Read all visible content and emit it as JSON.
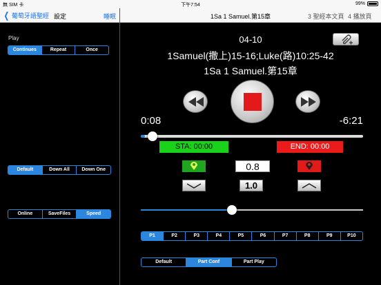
{
  "status_bar": {
    "carrier": "無 SIM 卡",
    "time": "下午7:54",
    "battery": "99%"
  },
  "sidebar": {
    "back_label": "葡萄牙語聖經",
    "title": "設定",
    "action": "睡眠",
    "play_label": "Play",
    "play_modes": [
      "Continues",
      "Repeat",
      "Once"
    ],
    "play_mode_selected": "Continues",
    "scroll_modes": [
      "Default",
      "Down All",
      "Down One"
    ],
    "scroll_mode_selected": "Default",
    "source_modes": [
      "Online",
      "SaveFiles",
      "Speed"
    ],
    "source_mode_selected": "Speed"
  },
  "player": {
    "chapter_title": "1Sa 1 Samuel.第15章",
    "nav_text_link": "3 聖經本文頁",
    "nav_play_link": "4 播放頁",
    "date": "04-10",
    "reading_ref": "1Samuel(撒上)15-16;Luke(路)10:25-42",
    "chapter_name": "1Sa 1 Samuel.第15章",
    "elapsed": "0:08",
    "remaining": "-6:21",
    "progress_fraction": 0.02,
    "sta_label": "STA: 00:00",
    "end_label": "END: 00:00",
    "rate_value": "0.8",
    "rate_reset_label": "1.0",
    "volume_fraction": 0.41,
    "parts": [
      "P1",
      "P2",
      "P3",
      "P4",
      "P5",
      "P6",
      "P7",
      "P8",
      "P9",
      "P10"
    ],
    "part_selected": "P1",
    "part_modes": [
      "Default",
      "Part Conf",
      "Part Play"
    ],
    "part_mode_selected": "Part Conf"
  },
  "colors": {
    "accent": "#2d86dd",
    "start_marker": "#19d219",
    "end_marker": "#ec1b1b"
  },
  "icons": [
    "back-chevron-icon",
    "attachment-icon",
    "rewind-icon",
    "stop-icon",
    "fast-forward-icon",
    "green-pin-icon",
    "red-pin-icon",
    "chevron-down-icon",
    "chevron-up-icon"
  ]
}
